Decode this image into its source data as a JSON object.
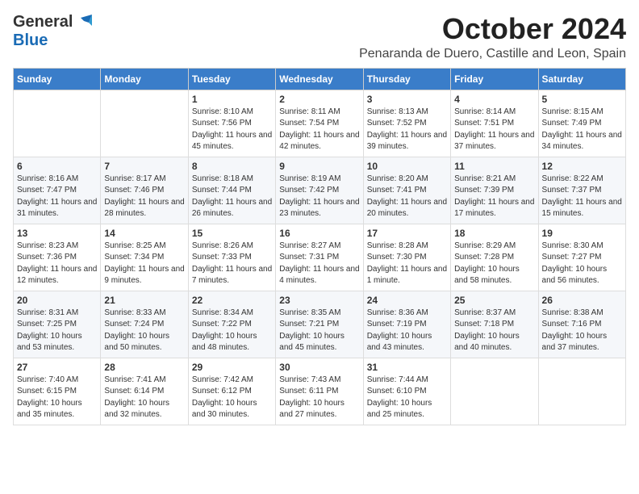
{
  "logo": {
    "general": "General",
    "blue": "Blue",
    "tagline": "GeneralBlue"
  },
  "title": {
    "month": "October 2024",
    "location": "Penaranda de Duero, Castille and Leon, Spain"
  },
  "weekdays": [
    "Sunday",
    "Monday",
    "Tuesday",
    "Wednesday",
    "Thursday",
    "Friday",
    "Saturday"
  ],
  "weeks": [
    [
      {
        "day": "",
        "sunrise": "",
        "sunset": "",
        "daylight": ""
      },
      {
        "day": "",
        "sunrise": "",
        "sunset": "",
        "daylight": ""
      },
      {
        "day": "1",
        "sunrise": "Sunrise: 8:10 AM",
        "sunset": "Sunset: 7:56 PM",
        "daylight": "Daylight: 11 hours and 45 minutes."
      },
      {
        "day": "2",
        "sunrise": "Sunrise: 8:11 AM",
        "sunset": "Sunset: 7:54 PM",
        "daylight": "Daylight: 11 hours and 42 minutes."
      },
      {
        "day": "3",
        "sunrise": "Sunrise: 8:13 AM",
        "sunset": "Sunset: 7:52 PM",
        "daylight": "Daylight: 11 hours and 39 minutes."
      },
      {
        "day": "4",
        "sunrise": "Sunrise: 8:14 AM",
        "sunset": "Sunset: 7:51 PM",
        "daylight": "Daylight: 11 hours and 37 minutes."
      },
      {
        "day": "5",
        "sunrise": "Sunrise: 8:15 AM",
        "sunset": "Sunset: 7:49 PM",
        "daylight": "Daylight: 11 hours and 34 minutes."
      }
    ],
    [
      {
        "day": "6",
        "sunrise": "Sunrise: 8:16 AM",
        "sunset": "Sunset: 7:47 PM",
        "daylight": "Daylight: 11 hours and 31 minutes."
      },
      {
        "day": "7",
        "sunrise": "Sunrise: 8:17 AM",
        "sunset": "Sunset: 7:46 PM",
        "daylight": "Daylight: 11 hours and 28 minutes."
      },
      {
        "day": "8",
        "sunrise": "Sunrise: 8:18 AM",
        "sunset": "Sunset: 7:44 PM",
        "daylight": "Daylight: 11 hours and 26 minutes."
      },
      {
        "day": "9",
        "sunrise": "Sunrise: 8:19 AM",
        "sunset": "Sunset: 7:42 PM",
        "daylight": "Daylight: 11 hours and 23 minutes."
      },
      {
        "day": "10",
        "sunrise": "Sunrise: 8:20 AM",
        "sunset": "Sunset: 7:41 PM",
        "daylight": "Daylight: 11 hours and 20 minutes."
      },
      {
        "day": "11",
        "sunrise": "Sunrise: 8:21 AM",
        "sunset": "Sunset: 7:39 PM",
        "daylight": "Daylight: 11 hours and 17 minutes."
      },
      {
        "day": "12",
        "sunrise": "Sunrise: 8:22 AM",
        "sunset": "Sunset: 7:37 PM",
        "daylight": "Daylight: 11 hours and 15 minutes."
      }
    ],
    [
      {
        "day": "13",
        "sunrise": "Sunrise: 8:23 AM",
        "sunset": "Sunset: 7:36 PM",
        "daylight": "Daylight: 11 hours and 12 minutes."
      },
      {
        "day": "14",
        "sunrise": "Sunrise: 8:25 AM",
        "sunset": "Sunset: 7:34 PM",
        "daylight": "Daylight: 11 hours and 9 minutes."
      },
      {
        "day": "15",
        "sunrise": "Sunrise: 8:26 AM",
        "sunset": "Sunset: 7:33 PM",
        "daylight": "Daylight: 11 hours and 7 minutes."
      },
      {
        "day": "16",
        "sunrise": "Sunrise: 8:27 AM",
        "sunset": "Sunset: 7:31 PM",
        "daylight": "Daylight: 11 hours and 4 minutes."
      },
      {
        "day": "17",
        "sunrise": "Sunrise: 8:28 AM",
        "sunset": "Sunset: 7:30 PM",
        "daylight": "Daylight: 11 hours and 1 minute."
      },
      {
        "day": "18",
        "sunrise": "Sunrise: 8:29 AM",
        "sunset": "Sunset: 7:28 PM",
        "daylight": "Daylight: 10 hours and 58 minutes."
      },
      {
        "day": "19",
        "sunrise": "Sunrise: 8:30 AM",
        "sunset": "Sunset: 7:27 PM",
        "daylight": "Daylight: 10 hours and 56 minutes."
      }
    ],
    [
      {
        "day": "20",
        "sunrise": "Sunrise: 8:31 AM",
        "sunset": "Sunset: 7:25 PM",
        "daylight": "Daylight: 10 hours and 53 minutes."
      },
      {
        "day": "21",
        "sunrise": "Sunrise: 8:33 AM",
        "sunset": "Sunset: 7:24 PM",
        "daylight": "Daylight: 10 hours and 50 minutes."
      },
      {
        "day": "22",
        "sunrise": "Sunrise: 8:34 AM",
        "sunset": "Sunset: 7:22 PM",
        "daylight": "Daylight: 10 hours and 48 minutes."
      },
      {
        "day": "23",
        "sunrise": "Sunrise: 8:35 AM",
        "sunset": "Sunset: 7:21 PM",
        "daylight": "Daylight: 10 hours and 45 minutes."
      },
      {
        "day": "24",
        "sunrise": "Sunrise: 8:36 AM",
        "sunset": "Sunset: 7:19 PM",
        "daylight": "Daylight: 10 hours and 43 minutes."
      },
      {
        "day": "25",
        "sunrise": "Sunrise: 8:37 AM",
        "sunset": "Sunset: 7:18 PM",
        "daylight": "Daylight: 10 hours and 40 minutes."
      },
      {
        "day": "26",
        "sunrise": "Sunrise: 8:38 AM",
        "sunset": "Sunset: 7:16 PM",
        "daylight": "Daylight: 10 hours and 37 minutes."
      }
    ],
    [
      {
        "day": "27",
        "sunrise": "Sunrise: 7:40 AM",
        "sunset": "Sunset: 6:15 PM",
        "daylight": "Daylight: 10 hours and 35 minutes."
      },
      {
        "day": "28",
        "sunrise": "Sunrise: 7:41 AM",
        "sunset": "Sunset: 6:14 PM",
        "daylight": "Daylight: 10 hours and 32 minutes."
      },
      {
        "day": "29",
        "sunrise": "Sunrise: 7:42 AM",
        "sunset": "Sunset: 6:12 PM",
        "daylight": "Daylight: 10 hours and 30 minutes."
      },
      {
        "day": "30",
        "sunrise": "Sunrise: 7:43 AM",
        "sunset": "Sunset: 6:11 PM",
        "daylight": "Daylight: 10 hours and 27 minutes."
      },
      {
        "day": "31",
        "sunrise": "Sunrise: 7:44 AM",
        "sunset": "Sunset: 6:10 PM",
        "daylight": "Daylight: 10 hours and 25 minutes."
      },
      {
        "day": "",
        "sunrise": "",
        "sunset": "",
        "daylight": ""
      },
      {
        "day": "",
        "sunrise": "",
        "sunset": "",
        "daylight": ""
      }
    ]
  ]
}
